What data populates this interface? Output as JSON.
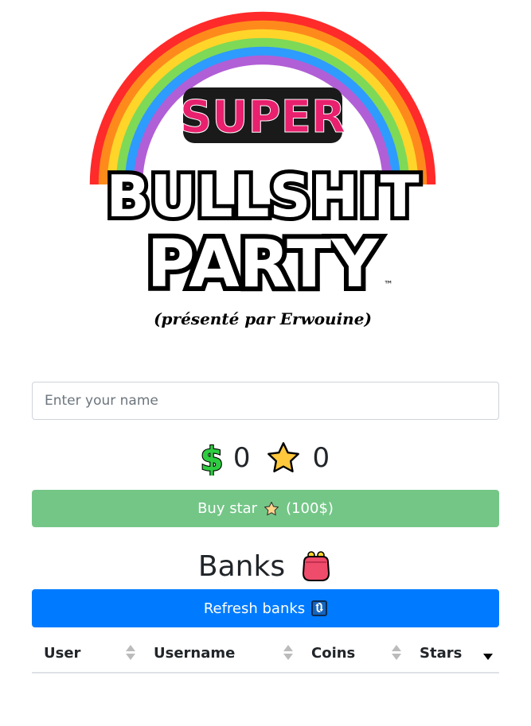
{
  "logo": {
    "line1": "SUPER",
    "line2": "BULLSHIT",
    "line3": "PARTY",
    "trademark": "™",
    "tagline": "(présenté par Erwouine)"
  },
  "name_input": {
    "placeholder": "Enter your name",
    "value": ""
  },
  "wallet": {
    "coins": "0",
    "stars": "0",
    "coin_icon": "dollar-icon",
    "star_icon": "star-icon"
  },
  "buy_button": {
    "label": "Buy star",
    "price": "(100$)"
  },
  "banks": {
    "title": "Banks",
    "icon": "purse-icon"
  },
  "refresh_button": {
    "label": "Refresh banks",
    "icon": "refresh-icon"
  },
  "table": {
    "columns": [
      {
        "label": "User",
        "sort": "none"
      },
      {
        "label": "Username",
        "sort": "none"
      },
      {
        "label": "Coins",
        "sort": "none"
      },
      {
        "label": "Stars",
        "sort": "desc"
      }
    ],
    "rows": []
  },
  "colors": {
    "buy": "#74c687",
    "refresh": "#007bff",
    "rainbow": [
      "#ff2a2a",
      "#ff8a1c",
      "#ffd52a",
      "#7ed957",
      "#2e9bff",
      "#b15fd6"
    ]
  }
}
